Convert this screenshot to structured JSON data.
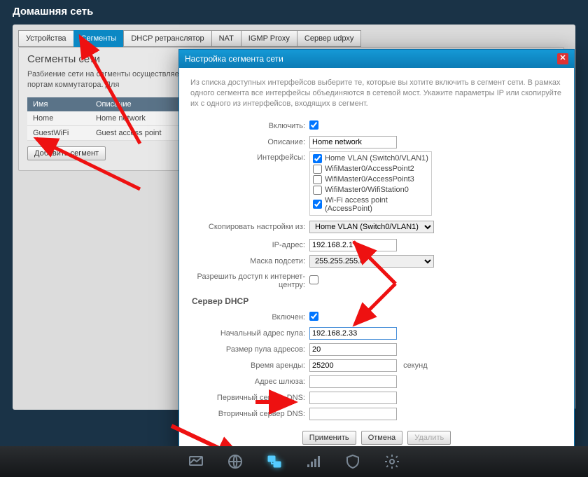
{
  "page": {
    "title": "Домашняя сеть"
  },
  "tabs": {
    "devices": "Устройства",
    "segments": "Сегменты",
    "dhcp_relay": "DHCP ретранслятор",
    "nat": "NAT",
    "igmp": "IGMP Proxy",
    "udpxy": "Сервер udpxy"
  },
  "segments_panel": {
    "title": "Сегменты сети",
    "desc": "Разбиение сети на сегменты осуществляется объединяет порты встроенного коммутат схемы предоставления услуг, для подклю привязанные к портам коммутатора. Для",
    "col_name": "Имя",
    "col_desc": "Описание",
    "rows": [
      {
        "name": "Home",
        "desc": "Home network"
      },
      {
        "name": "GuestWiFi",
        "desc": "Guest access point"
      }
    ],
    "add_btn": "Добавить сегмент"
  },
  "modal": {
    "title": "Настройка сегмента сети",
    "intro": "Из списка доступных интерфейсов выберите те, которые вы хотите включить в сегмент сети. В рамках одного сегмента все интерфейсы объединяются в сетевой мост. Укажите параметры IP или скопируйте их с одного из интерфейсов, входящих в сегмент.",
    "labels": {
      "enable": "Включить:",
      "description": "Описание:",
      "interfaces": "Интерфейсы:",
      "copy_from": "Скопировать настройки из:",
      "ip": "IP-адрес:",
      "mask": "Маска подсети:",
      "allow_web": "Разрешить доступ к интернет-центру:",
      "dhcp_header": "Сервер DHCP",
      "dhcp_enable": "Включен:",
      "pool_start": "Начальный адрес пула:",
      "pool_size": "Размер пула адресов:",
      "lease": "Время аренды:",
      "lease_unit": "секунд",
      "gateway": "Адрес шлюза:",
      "dns1": "Первичный сервер DNS:",
      "dns2": "Вторичный сервер DNS:"
    },
    "values": {
      "description": "Home network",
      "copy_from": "Home VLAN (Switch0/VLAN1)",
      "ip": "192.168.2.1",
      "mask": "255.255.255.0",
      "pool_start": "192.168.2.33",
      "pool_size": "20",
      "lease": "25200",
      "gateway": "",
      "dns1": "",
      "dns2": ""
    },
    "interfaces": [
      {
        "label": "Home VLAN (Switch0/VLAN1)",
        "checked": true
      },
      {
        "label": "WifiMaster0/AccessPoint2",
        "checked": false
      },
      {
        "label": "WifiMaster0/AccessPoint3",
        "checked": false
      },
      {
        "label": "WifiMaster0/WifiStation0",
        "checked": false
      },
      {
        "label": "Wi-Fi access point (AccessPoint)",
        "checked": true
      }
    ],
    "buttons": {
      "apply": "Применить",
      "cancel": "Отмена",
      "delete": "Удалить"
    }
  }
}
